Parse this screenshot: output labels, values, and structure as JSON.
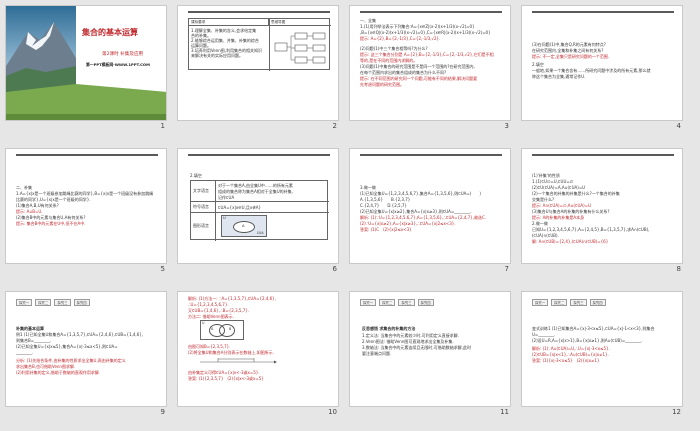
{
  "slides": [
    {
      "number": "1",
      "title": "集合的基本运算",
      "subtitle": "第2课时 补集及应用",
      "footer": "第一PPT模板网-WWW.1PPT.COM"
    },
    {
      "number": "2",
      "table_head": [
        "课标要求",
        "思维导图"
      ],
      "goals": [
        "1.理解全集、补集的含义,会求给定集",
        "合的补集。",
        "2.能够综合运用集、并集、补集的综合",
        "运算问题。",
        "3.培养利用Venn图,利用集合的相关知识",
        "来解决有关的实际应用问题。"
      ]
    },
    {
      "number": "3",
      "lines": [
        "一、全集",
        "1.(1)用列举法表示下列集合:A={x∈Z|(x-2)(x+1/3)(x-√2)=0}",
        ",B={x∈Q|(x-2)(x+1/3)(x-√2)=0},C={x∈R|(x-2)(x+1/3)(x-√2)=0}",
        "提示: A={2},B={2,-1/3},C={2,-1/3,√2}.",
        "(2)问题(1)中三个集合相等吗?为什么?",
        "提示: 这三个集合分别是 A={2},B={2,-1/3},C={2,-1/3,√2},它们是不相",
        "等的,是在不同的范围内求解的。",
        "(3)问题(1)中集合的研究范围是不是同一个范围的?在研究范围内,",
        "在每个范围内求出的集合组成的集合为什么不同?",
        "提示: 在不同范围内研究同一个问题,可能有不同的结果,解决问题要",
        "先考虑问题的研究范围。"
      ]
    },
    {
      "number": "4",
      "lines": [
        "(3)在问题(1)中,集合Q,R的元素有何特点?",
        "在研究范围内,全集和补集之间有何关系?",
        "提示: 不一定,全集只是研究问题的一个范围.",
        "2.填空",
        "一般地,如果一个集合含有……所研究问题中涉及的所有元素,那么就",
        "称这个集合为全集,通常记作U."
      ]
    },
    {
      "number": "5",
      "lines": [
        "二、补集",
        "1.A={x|x是一个班级参加跳绳比赛的同学},B={x|x是一个班级没有参加跳绳",
        "比赛的同学},U={x|x是一个班级的同学}.",
        "(1)集合A,B,U有何关系?",
        "提示: A∪B=U.",
        "(2)集合B中的元素与集合U,A有何关系?",
        "提示: 集合B中的元素在U中,但不在A中."
      ]
    },
    {
      "number": "6",
      "heading": "2.填空",
      "rows": [
        "文字语言",
        "符号语言",
        "图形语言"
      ],
      "text_cells": [
        "对于一个集合A,由全集U中……的所有元素",
        "组成的集合称为集合A相对于全集U的补集,",
        "记作∁UA",
        "∁UA={x|x∈U,且x∉A}"
      ],
      "venn_labels": [
        "U",
        "A",
        "∁UA"
      ]
    },
    {
      "number": "7",
      "lines": [
        "3.做一做",
        "(1)已知全集U={1,2,3,4,5,6,7},集合A={1,3,5,6},则∁UA=(　　)",
        "A.{1,3,5,6}　　B.{2,3,7}",
        "C.{2,4,7}　　D.{2,5,7}",
        "(2)已知全集U={x|x≥2},集合A={x|x≥3},则∁UA=________.",
        "解析: (1)∵U={1,2,3,4,5,6,7},A={1,3,5,6},∴∁UA={2,4,7},故选C.",
        "(2)∵U={x|x≥2},A={x|x≥3},∴∁UA={x|2≤x<3}.",
        "答案: (1)C　(2){x|2≤x<3}"
      ]
    },
    {
      "number": "8",
      "lines": [
        "(1)'补集'的性质",
        "1.(1)∁U∅=U,∁UU=∅",
        "(2)∁U(∁UA)=A,A∪(∁UA)=U",
        "(2)一个集合的补集的补集是什么?一个集合的补集",
        "交集是什么?",
        "提示: A∩(∁UA)=∅,A∪(∁UA)=U",
        "(3)集合U与集合A的补集的补集有什么关系?",
        "提示: A的补集的补集是A本身",
        "2.做一做",
        "已知U={1,2,3,4,5,6,7},A={2,4,5},B={1,3,5,7},求A∩(∁UB),",
        "(∁UA)∩(∁UB).",
        "解: A∩(∁UB)={2,4},(∁UA)∩(∁UB)={6}"
      ]
    },
    {
      "number": "9",
      "tabs": [
        "探究一",
        "探究二",
        "探究三",
        "探究四"
      ],
      "lines": [
        "补集的基本运算",
        "例1 (1)已知全集U和集合A={1,3,5,7},∁UA={2,4,6},∁UB={1,4,6},",
        "则集合B=________.",
        "(2)已知全集U={x|x≤5},集合A={x|-3≤x<5},则∁UA=",
        "________.",
        "分析: (1)先结合条件,由补集的性质求出全集U,再由补集的定义",
        "求出集合B,也可借助Venn图求解.",
        "(2)利用补集的定义,借助于数轴的直观作用求解."
      ]
    },
    {
      "number": "10",
      "lines": [
        "解析: (1)方法一: ∵A={1,3,5,7},∁UA={2,4,6},",
        "∴U={1,2,3,4,5,6,7}.",
        "又∁UB={1,4,6},∴B={2,3,5,7}.",
        "方法二: 借助Venn图表示.",
        "由图可知B={2,3,5,7}.",
        "(2)将全集U和集合A分别表示在数轴上,如图所示.",
        "由补集定义可得∁UA={x|x<-3或x=5}.",
        "答案: (1){2,3,5,7}　(2){x|x<-3或x=5}"
      ],
      "venn_labels": [
        "U",
        "A",
        "B"
      ]
    },
    {
      "number": "11",
      "tabs": [
        "探究一",
        "探究二",
        "探究三",
        "探究四"
      ],
      "lines": [
        "反思感悟 求集合的补集的方法",
        "1.定义法: 当集合中的元素较少时,可利用定义直接求解.",
        "2.Venn图法: 借助Venn图可直观地求出全集及补集.",
        "3.数轴法: 当集合中的元素连续且无限时,可借助数轴求解,此时",
        "要注意端点问题."
      ]
    },
    {
      "number": "12",
      "tabs": [
        "探究一",
        "探究二",
        "探究三",
        "探究四"
      ],
      "lines": [
        "变式训练1 (1)已知集合A={x|-3<x≤5},∁UA={x|-1<x<3},则集合",
        "U=________.",
        "(2)设U=R,A={x|x>1},B={x|x≥1},则A∪(∁UB)=________.",
        "解析: (1)∵A∪(∁UA)=U,∴U={x|-3<x≤5}.",
        "(2)∁UB={x|x<1},∴A∪(∁UB)={x|x≠1}.",
        "答案: (1){x|-3<x≤5}　(2){x|x≠1}"
      ]
    }
  ]
}
